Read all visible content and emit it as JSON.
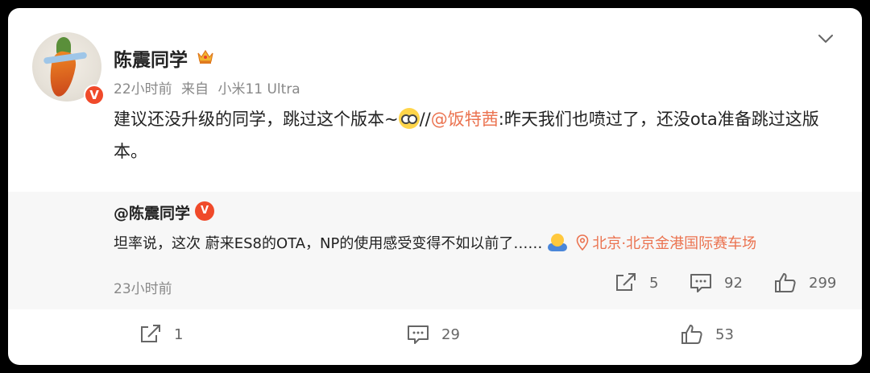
{
  "post": {
    "username": "陈震同学",
    "time": "22小时前",
    "source_prefix": "来自",
    "source_device": "小米11 Ultra",
    "text_part1": "建议还没升级的同学，跳过这个版本~",
    "text_part2": "//",
    "mention": "@饭特茜",
    "text_part3": ":昨天我们也喷过了，还没ota准备跳过这版本。",
    "verified_badge": "V",
    "icons": {
      "crown": "crown-icon",
      "more": "chevron-down-icon"
    }
  },
  "quoted": {
    "username": "@陈震同学",
    "verified_badge": "V",
    "text": "坦率说，这次 蔚来ES8的OTA，NP的使用感受变得不如以前了……",
    "location": "北京·北京金港国际赛车场",
    "time": "23小时前",
    "repost_count": "5",
    "comment_count": "92",
    "like_count": "299"
  },
  "actions": {
    "repost_count": "1",
    "comment_count": "29",
    "like_count": "53"
  },
  "colors": {
    "accent": "#eb7350",
    "badge": "#f04a2a",
    "muted": "#888888"
  }
}
